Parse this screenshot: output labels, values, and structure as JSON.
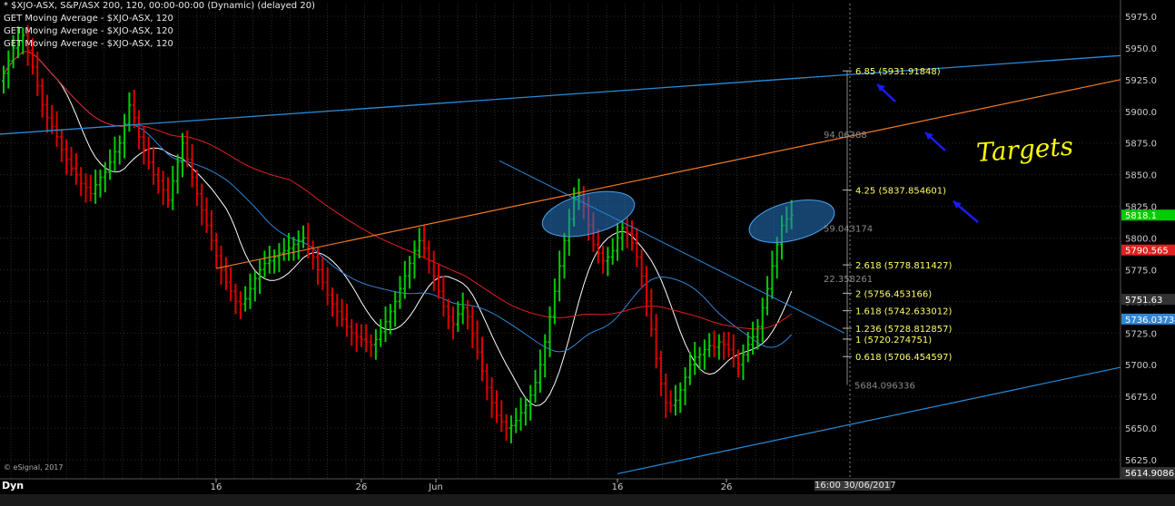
{
  "header": {
    "line1": "* $XJO-ASX, S&P/ASX 200, 120, 00:00-00:00 (Dynamic) (delayed 20)",
    "line2": "GET Moving Average - $XJO-ASX, 120",
    "line3": "GET Moving Average - $XJO-ASX, 120",
    "line4": "GET Moving Average - $XJO-ASX, 120"
  },
  "footer": {
    "copyright": "© eSignal, 2017",
    "corner_label": "Dyn",
    "cursor_time": "16:00 30/06/2017"
  },
  "annotation": {
    "text": "Targets",
    "color": "#ffff00",
    "arrow_color": "#1a1aff"
  },
  "colors": {
    "up_bar": "#00cc00",
    "down_bar": "#dd0000",
    "ma_white": "#ffffff",
    "ma_red": "#e02020",
    "ma_blue": "#2f86d6",
    "trend_blue": "#2a8ad8",
    "trend_orange": "#f07a28",
    "fib_label": "#ffff66",
    "grid": "#2a2a2a",
    "axis_text": "#cccccc"
  },
  "chart_data": {
    "type": "bar",
    "subtype": "ohlc",
    "timeframe": "120",
    "ylim": [
      5610,
      5985
    ],
    "yticks": [
      5625,
      5650,
      5675,
      5700,
      5725,
      5750,
      5775,
      5800,
      5825,
      5850,
      5875,
      5900,
      5925,
      5950,
      5975
    ],
    "xtick_labels": [
      "16",
      "26",
      "Jun",
      "16",
      "26"
    ],
    "grid": true,
    "price_markers": [
      {
        "label": "5818.1",
        "value": 5818.1,
        "color": "#00cc00"
      },
      {
        "label": "5790.565",
        "value": 5790.565,
        "color": "#e02020"
      },
      {
        "label": "5751.63",
        "value": 5751.63,
        "color": "#333333"
      },
      {
        "label": "5736.03734",
        "value": 5736.03734,
        "color": "#2f86d6"
      },
      {
        "label": "5614.90862",
        "value": 5614.90862,
        "color": "#333333"
      }
    ],
    "fib_levels": [
      {
        "label": "6.85 (5931.91848)",
        "value": 5931.91848
      },
      {
        "label": "4.25 (5837.854601)",
        "value": 5837.854601
      },
      {
        "label": "2.618 (5778.811427)",
        "value": 5778.811427
      },
      {
        "label": "2 (5756.453166)",
        "value": 5756.453166
      },
      {
        "label": "1.618 (5742.633012)",
        "value": 5742.633012
      },
      {
        "label": "1.236 (5728.812857)",
        "value": 5728.812857
      },
      {
        "label": "1 (5720.274751)",
        "value": 5720.274751
      },
      {
        "label": "0.618 (5706.454597)",
        "value": 5706.454597
      }
    ],
    "measure_labels": [
      {
        "label": "94.06388",
        "value": 5882
      },
      {
        "label": "59.043174",
        "value": 5808
      },
      {
        "label": "22.358261",
        "value": 5768
      },
      {
        "label": "5684.096336",
        "value": 5684.096336
      }
    ],
    "close_series": [
      5930,
      5940,
      5950,
      5955,
      5960,
      5948,
      5935,
      5920,
      5905,
      5895,
      5888,
      5880,
      5870,
      5862,
      5855,
      5850,
      5843,
      5840,
      5835,
      5842,
      5848,
      5852,
      5860,
      5868,
      5875,
      5890,
      5905,
      5895,
      5880,
      5870,
      5860,
      5850,
      5845,
      5838,
      5830,
      5845,
      5860,
      5875,
      5862,
      5848,
      5835,
      5822,
      5810,
      5798,
      5786,
      5775,
      5765,
      5758,
      5750,
      5748,
      5752,
      5760,
      5768,
      5775,
      5780,
      5782,
      5785,
      5788,
      5790,
      5792,
      5795,
      5798,
      5800,
      5792,
      5785,
      5775,
      5765,
      5755,
      5748,
      5742,
      5736,
      5730,
      5725,
      5722,
      5720,
      5718,
      5716,
      5720,
      5726,
      5734,
      5742,
      5750,
      5760,
      5770,
      5780,
      5790,
      5798,
      5792,
      5782,
      5770,
      5758,
      5746,
      5738,
      5732,
      5740,
      5745,
      5738,
      5725,
      5710,
      5695,
      5682,
      5670,
      5660,
      5655,
      5650,
      5652,
      5656,
      5662,
      5668,
      5676,
      5686,
      5700,
      5718,
      5738,
      5758,
      5778,
      5798,
      5815,
      5830,
      5835,
      5825,
      5810,
      5795,
      5788,
      5782,
      5785,
      5790,
      5800,
      5808,
      5804,
      5796,
      5785,
      5770,
      5750,
      5728,
      5705,
      5685,
      5670,
      5668,
      5672,
      5680,
      5690,
      5700,
      5706,
      5708,
      5712,
      5715,
      5714,
      5718,
      5716,
      5712,
      5706,
      5700,
      5708,
      5716,
      5722,
      5730,
      5745,
      5760,
      5778,
      5795,
      5810,
      5815,
      5818
    ]
  }
}
